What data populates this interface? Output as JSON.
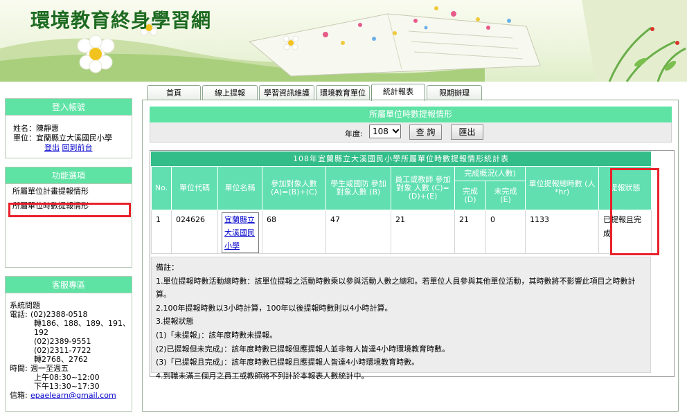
{
  "site": {
    "title": "環境教育終身學習網"
  },
  "tabs": [
    "首頁",
    "線上提報",
    "學習資訊維護",
    "環境教育單位",
    "統計報表",
    "限期辦理"
  ],
  "active_tab": "統計報表",
  "login": {
    "header": "登入帳號",
    "name_label": "姓名：",
    "name": "陳靜惠",
    "unit_label": "單位：",
    "unit": "宜蘭縣立大溪國民小學",
    "logout": "登出",
    "back": "回到前台"
  },
  "func": {
    "header": "功能選項",
    "items": [
      "所屬單位計畫提報情形",
      "所屬單位時數提報情形"
    ]
  },
  "service": {
    "header": "客服專區",
    "sys_label": "系統問題",
    "tel_label": "電話:",
    "tel1": "(02)2388-0518",
    "ext1": "轉186、188、189、191、192",
    "tel2": "(02)2389-9551",
    "tel3": "(02)2311-7722",
    "ext3": "轉2768、2762",
    "time_label": "時間:",
    "days": "週一至週五",
    "am": "上午08:30~12:00",
    "pm": "下午13:30~17:30",
    "mail_label": "信箱:",
    "email": "epaelearn@gmail.com"
  },
  "main": {
    "title": "所屬單位時數提報情形",
    "year_label": "年度:",
    "year": "108",
    "query": "查 詢",
    "export": "匯出"
  },
  "report": {
    "title": "108年宜蘭縣立大溪國民小學所屬單位時數提報情形統計表",
    "headers": {
      "no": "No.",
      "code": "單位代碼",
      "name": "單位名稱",
      "participants": "參加對象人數 (A)=(B)+(C)",
      "students": "學生或國防 參加對象人數 (B)",
      "staff": "員工或教師 參加對象 人數 (C)=(D)+(E)",
      "completion": "完成概況(人數)",
      "done": "完成 (D)",
      "undone": "未完成 (E)",
      "hours": "單位提報總時數 (人*hr)",
      "status": "提報狀態"
    },
    "rows": [
      {
        "no": "1",
        "code": "024626",
        "name": "宜蘭縣立大溪國民小學",
        "participants": "68",
        "students": "47",
        "staff": "21",
        "done": "21",
        "undone": "0",
        "hours": "1133",
        "status": "已提報且完成"
      }
    ],
    "notes": [
      "備註：",
      "1.單位提報時數活動總時數：該單位提報之活動時數乘以參與活動人數之總和。若單位人員參與其他單位活動，其時數將不影響此項目之時數計算。",
      "2.100年提報時數以3小時計算，100年以後提報時數則以4小時計算。",
      "3.提報狀態",
      "(1)「未提報」：該年度時數未提報。",
      "(2)已提報但未完成」：該年度時數已提報但應提報人並非每人皆達4小時環境教育時數。",
      "(3)「已提報且完成」：該年度時數已提報且應提報人皆達4小時環境教育時數。",
      "4.到職未滿三個月之員工或教師將不列計於本報表人數統計中。"
    ]
  },
  "colors": {
    "accent_green": "#5ee3a5",
    "header_green": "#33bd89",
    "highlight_red": "#e8202a",
    "link_blue": "#0000cc"
  }
}
